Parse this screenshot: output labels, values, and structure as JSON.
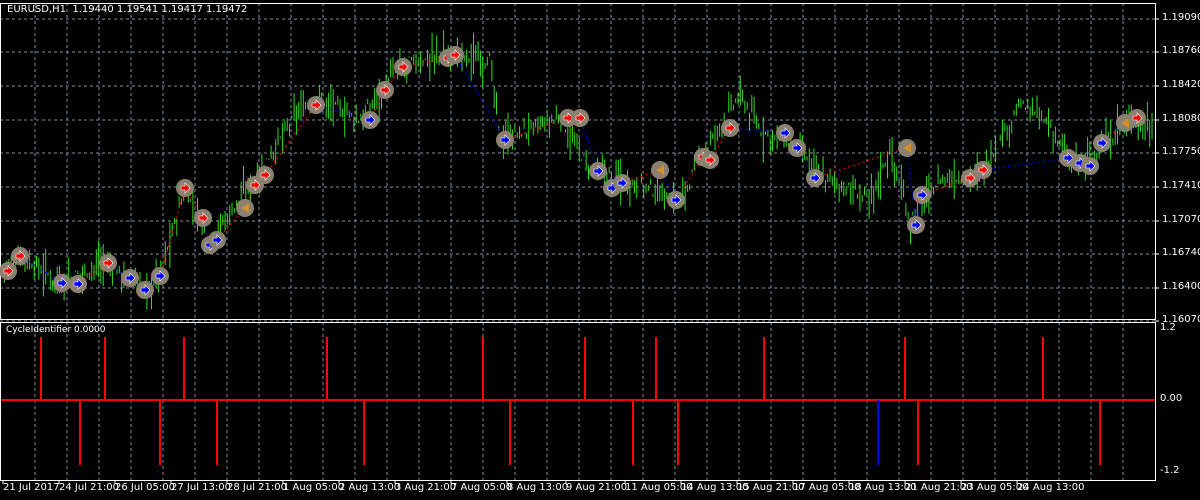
{
  "header": {
    "symbol_timeframe": "EURUSD,H1",
    "open": "1.19440",
    "high": "1.19541",
    "low": "1.19417",
    "close": "1.19472"
  },
  "indicator": {
    "name": "CycleIdentifier",
    "value": "0.0000"
  },
  "colors": {
    "background": "#000000",
    "bars": "#33dd22",
    "grid": "#8090a0",
    "signal": "#ff0000",
    "buy": "#0000ff",
    "sell": "#ff0000",
    "marker": "#8a8070",
    "axis": "#ffffff"
  },
  "chart_data": {
    "type": "bar",
    "price_axis": {
      "labels": [
        "1.19090",
        "1.18760",
        "1.18420",
        "1.18080",
        "1.17750",
        "1.17410",
        "1.17070",
        "1.16740",
        "1.16400",
        "1.16070"
      ],
      "range": [
        1.1604,
        1.1918
      ]
    },
    "indicator_axis": {
      "labels": [
        "1.2",
        "0.00",
        "-1.2"
      ],
      "range": [
        -1.3,
        1.3
      ]
    },
    "time_labels": [
      "21 Jul 2017",
      "24 Jul 21:00",
      "26 Jul 05:00",
      "27 Jul 13:00",
      "28 Jul 21:00",
      "1 Aug 05:00",
      "2 Aug 13:00",
      "3 Aug 21:00",
      "7 Aug 05:00",
      "8 Aug 13:00",
      "9 Aug 21:00",
      "11 Aug 05:00",
      "14 Aug 13:00",
      "15 Aug 21:00",
      "17 Aug 05:00",
      "18 Aug 13:00",
      "21 Aug 21:00",
      "23 Aug 05:00",
      "24 Aug 13:00"
    ],
    "price_path": [
      [
        0,
        1.1657
      ],
      [
        20,
        1.1673
      ],
      [
        60,
        1.1645
      ],
      [
        105,
        1.1666
      ],
      [
        145,
        1.1638
      ],
      [
        160,
        1.1653
      ],
      [
        185,
        1.1738
      ],
      [
        210,
        1.1688
      ],
      [
        250,
        1.1743
      ],
      [
        300,
        1.1818
      ],
      [
        320,
        1.1828
      ],
      [
        360,
        1.1808
      ],
      [
        400,
        1.1863
      ],
      [
        450,
        1.1873
      ],
      [
        490,
        1.1868
      ],
      [
        500,
        1.1788
      ],
      [
        560,
        1.181
      ],
      [
        590,
        1.1758
      ],
      [
        640,
        1.1743
      ],
      [
        680,
        1.1728
      ],
      [
        700,
        1.1768
      ],
      [
        740,
        1.1833
      ],
      [
        760,
        1.1798
      ],
      [
        800,
        1.1778
      ],
      [
        820,
        1.1753
      ],
      [
        870,
        1.1728
      ],
      [
        890,
        1.1778
      ],
      [
        910,
        1.1708
      ],
      [
        940,
        1.1748
      ],
      [
        980,
        1.1753
      ],
      [
        1020,
        1.1823
      ],
      [
        1050,
        1.1803
      ],
      [
        1070,
        1.1763
      ],
      [
        1100,
        1.1778
      ],
      [
        1130,
        1.1808
      ],
      [
        1155,
        1.1798
      ]
    ],
    "up_signals_bar_x": [
      41,
      105,
      184,
      327,
      483,
      585,
      656,
      764,
      905,
      1043
    ],
    "down_signals_bar_x": [
      80,
      160,
      217,
      364,
      510,
      633,
      678,
      918,
      1100
    ],
    "down_signals_blue_bar_x": [
      878
    ],
    "markers": [
      [
        8,
        1.1657,
        "s"
      ],
      [
        20,
        1.1672,
        "s"
      ],
      [
        62,
        1.1645,
        "b"
      ],
      [
        78,
        1.1644,
        "b"
      ],
      [
        108,
        1.1665,
        "s"
      ],
      [
        130,
        1.165,
        "b"
      ],
      [
        145,
        1.1638,
        "b"
      ],
      [
        160,
        1.1652,
        "b"
      ],
      [
        185,
        1.174,
        "s"
      ],
      [
        203,
        1.171,
        "s"
      ],
      [
        210,
        1.1683,
        "b"
      ],
      [
        217,
        1.1688,
        "b"
      ],
      [
        245,
        1.172,
        "t"
      ],
      [
        255,
        1.1743,
        "s"
      ],
      [
        265,
        1.1753,
        "s"
      ],
      [
        316,
        1.1823,
        "s"
      ],
      [
        370,
        1.1808,
        "b"
      ],
      [
        385,
        1.1838,
        "s"
      ],
      [
        403,
        1.1861,
        "s"
      ],
      [
        448,
        1.187,
        "s"
      ],
      [
        455,
        1.1873,
        "s"
      ],
      [
        505,
        1.1788,
        "b"
      ],
      [
        568,
        1.181,
        "s"
      ],
      [
        580,
        1.181,
        "s"
      ],
      [
        598,
        1.1757,
        "b"
      ],
      [
        612,
        1.174,
        "b"
      ],
      [
        622,
        1.1745,
        "b"
      ],
      [
        660,
        1.1758,
        "t"
      ],
      [
        676,
        1.1728,
        "b"
      ],
      [
        703,
        1.1771,
        "s"
      ],
      [
        710,
        1.1768,
        "s"
      ],
      [
        730,
        1.18,
        "s"
      ],
      [
        785,
        1.1795,
        "b"
      ],
      [
        797,
        1.178,
        "b"
      ],
      [
        815,
        1.175,
        "b"
      ],
      [
        907,
        1.178,
        "t"
      ],
      [
        916,
        1.1703,
        "b"
      ],
      [
        922,
        1.1733,
        "b"
      ],
      [
        970,
        1.175,
        "s"
      ],
      [
        983,
        1.1758,
        "s"
      ],
      [
        1068,
        1.177,
        "b"
      ],
      [
        1080,
        1.1765,
        "b"
      ],
      [
        1090,
        1.1762,
        "b"
      ],
      [
        1102,
        1.1785,
        "b"
      ],
      [
        1125,
        1.1805,
        "t"
      ],
      [
        1137,
        1.181,
        "s"
      ]
    ]
  }
}
